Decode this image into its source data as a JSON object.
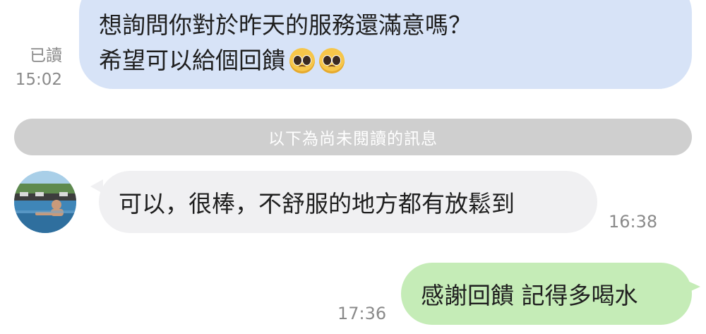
{
  "messages": {
    "outgoing_blue": {
      "line1": "想詢問你對於昨天的服務還滿意嗎？",
      "line2_text": "希望可以給個回饋",
      "emojis": [
        "pleading-face-emoji",
        "pleading-face-emoji"
      ],
      "read_label": "已讀",
      "time": "15:02"
    },
    "unread_divider": "以下為尚未閱讀的訊息",
    "incoming": {
      "text": "可以，很棒，不舒服的地方都有放鬆到",
      "time": "16:38",
      "avatar": "user-avatar-pool-photo"
    },
    "outgoing_green": {
      "text": "感謝回饋 記得多喝水",
      "time": "17:36"
    }
  },
  "colors": {
    "bubble_blue": "#d7e3f7",
    "bubble_incoming": "#f0f0f2",
    "bubble_green": "#c5ecb7",
    "divider": "#cfcfcf",
    "meta_text": "#8a8a8a"
  }
}
